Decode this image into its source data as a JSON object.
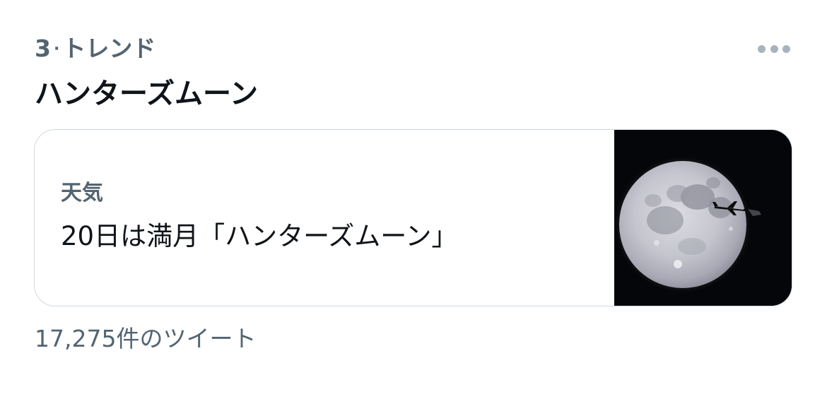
{
  "trend": {
    "rank": "3",
    "separator": "·",
    "context": "トレンド",
    "title": "ハンターズムーン",
    "more_icon": "ellipsis-icon",
    "card": {
      "category": "天気",
      "headline": "20日は満月「ハンターズムーン」",
      "image_icon": "full-moon-with-airplane"
    },
    "tweet_count": "17,275件のツイート"
  }
}
